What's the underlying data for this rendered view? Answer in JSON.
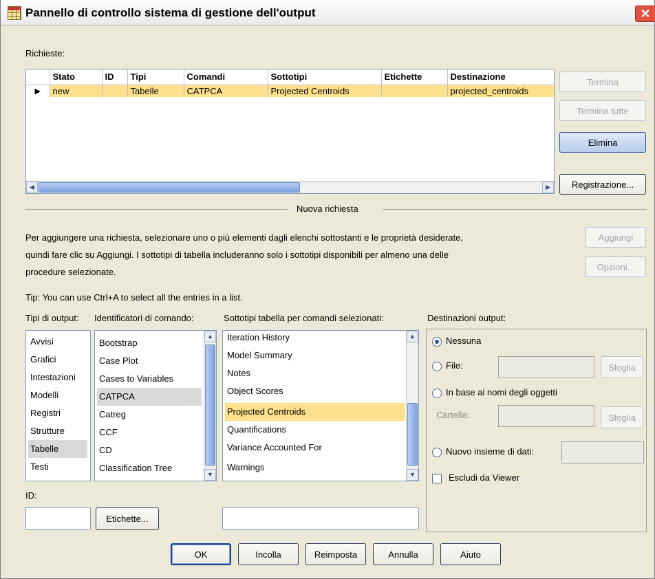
{
  "window": {
    "title": "Pannello di controllo sistema di gestione dell'output"
  },
  "requests": {
    "label": "Richieste:",
    "columns": [
      "Stato",
      "ID",
      "Tipi",
      "Comandi",
      "Sottotipi",
      "Etichette",
      "Destinazione"
    ],
    "rows": [
      {
        "stato": "new",
        "id": "",
        "tipi": "Tabelle",
        "comandi": "CATPCA",
        "sottotipi": "Projected Centroids",
        "etichette": "",
        "destinazione": "projected_centroids"
      }
    ]
  },
  "side_buttons": {
    "termina": "Termina",
    "termina_tutte": "Termina tutte",
    "elimina": "Elimina",
    "registrazione": "Registrazione..."
  },
  "new_request": {
    "title": "Nuova richiesta",
    "instructions": [
      "Per aggiungere una richiesta, selezionare uno o più elementi dagli elenchi sottostanti e le proprietà desiderate,",
      "quindi fare clic su Aggiungi. I sottotipi di tabella includeranno solo i sottotipi disponibili per almeno una delle",
      "procedure selezionate."
    ],
    "aggiungi": "Aggiungi",
    "opzioni": "Opzioni...",
    "tip": "Tip: You can use Ctrl+A to select all the entries in a list."
  },
  "output_types": {
    "label": "Tipi di output:",
    "items": [
      "Avvisi",
      "Grafici",
      "Intestazioni",
      "Modelli",
      "Registri",
      "Strutture",
      "Tabelle",
      "Testi"
    ],
    "selected": "Tabelle"
  },
  "command_ids": {
    "label": "Identificatori di comando:",
    "items": [
      "Bootstrap",
      "Case Plot",
      "Cases to Variables",
      "CATPCA",
      "Catreg",
      "CCF",
      "CD",
      "Classification Tree"
    ],
    "selected": "CATPCA"
  },
  "table_subtypes": {
    "label": "Sottotipi tabella per comandi selezionati:",
    "items": [
      "Iteration History",
      "Model Summary",
      "Notes",
      "Object Scores",
      "Projected Centroids",
      "Quantifications",
      "Variance Accounted For",
      "Warnings"
    ],
    "selected": "Projected Centroids"
  },
  "destinations": {
    "label": "Destinazioni output:",
    "nessuna": "Nessuna",
    "file": "File:",
    "sfoglia": "Sfoglia",
    "by_object_names": "In base ai nomi degli oggetti",
    "cartella": "Cartella:",
    "new_dataset": "Nuovo insieme di dati:",
    "exclude_viewer": "Escludi da Viewer",
    "selected": "Nessuna"
  },
  "id_section": {
    "label": "ID:",
    "value": "",
    "labels_button": "Etichette..."
  },
  "footer": {
    "ok": "OK",
    "incolla": "Incolla",
    "reimposta": "Reimposta",
    "annulla": "Annulla",
    "aiuto": "Aiuto"
  }
}
